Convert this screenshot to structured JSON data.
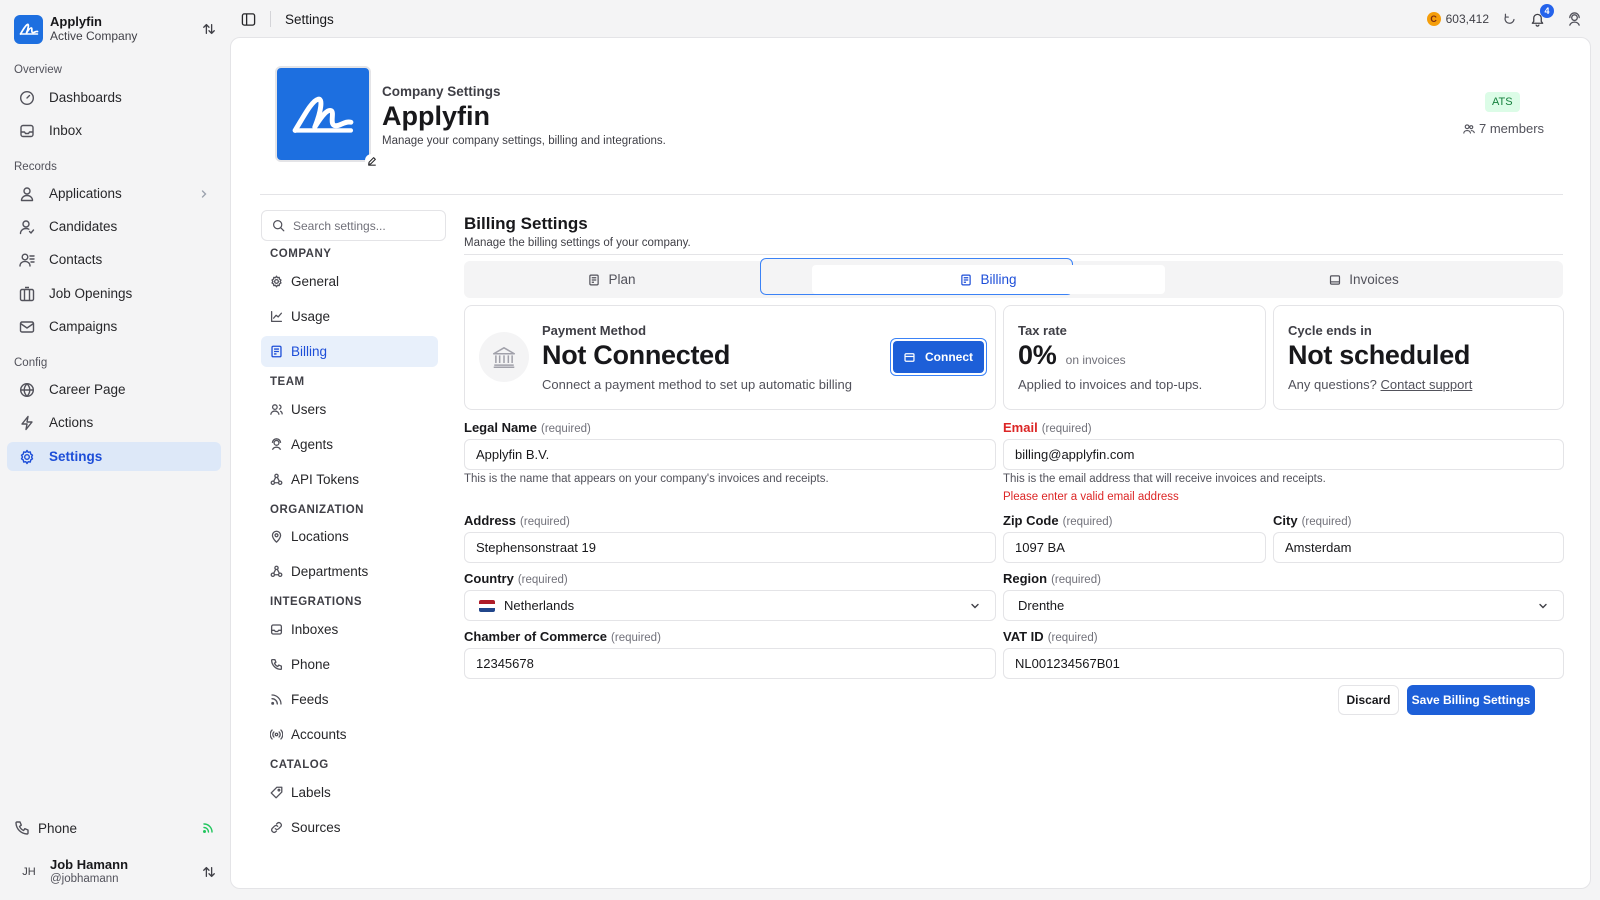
{
  "sidebar": {
    "company_name": "Applyfin",
    "company_sub": "Active Company",
    "sections": [
      "Overview",
      "Records",
      "Config"
    ],
    "items": [
      {
        "label": "Dashboards"
      },
      {
        "label": "Inbox"
      },
      {
        "label": "Applications"
      },
      {
        "label": "Candidates"
      },
      {
        "label": "Contacts"
      },
      {
        "label": "Job Openings"
      },
      {
        "label": "Campaigns"
      },
      {
        "label": "Career Page"
      },
      {
        "label": "Actions"
      },
      {
        "label": "Settings"
      }
    ],
    "phone_label": "Phone",
    "user": {
      "initials": "JH",
      "name": "Job Hamann",
      "handle": "@jobhamann"
    }
  },
  "topbar": {
    "breadcrumb": "Settings",
    "coin_symbol": "C",
    "credits": "603,412",
    "notification_count": "4"
  },
  "header": {
    "small_title": "Company Settings",
    "title": "Applyfin",
    "description": "Manage your company settings, billing and integrations.",
    "badge": "ATS",
    "members": "7 members"
  },
  "settings_nav": {
    "search_placeholder": "Search settings...",
    "groups": [
      "COMPANY",
      "TEAM",
      "ORGANIZATION",
      "INTEGRATIONS",
      "CATALOG"
    ],
    "items": [
      {
        "label": "General"
      },
      {
        "label": "Usage"
      },
      {
        "label": "Billing"
      },
      {
        "label": "Users"
      },
      {
        "label": "Agents"
      },
      {
        "label": "API Tokens"
      },
      {
        "label": "Locations"
      },
      {
        "label": "Departments"
      },
      {
        "label": "Inboxes"
      },
      {
        "label": "Phone"
      },
      {
        "label": "Feeds"
      },
      {
        "label": "Accounts"
      },
      {
        "label": "Labels"
      },
      {
        "label": "Sources"
      }
    ]
  },
  "billing": {
    "title": "Billing Settings",
    "description": "Manage the billing settings of your company.",
    "tabs": [
      {
        "label": "Plan"
      },
      {
        "label": "Billing"
      },
      {
        "label": "Invoices"
      }
    ],
    "active_tab": "Billing",
    "payment": {
      "label": "Payment Method",
      "status": "Not Connected",
      "subtitle": "Connect a payment method to set up automatic billing",
      "button": "Connect"
    },
    "tax": {
      "label": "Tax rate",
      "value": "0%",
      "unit": "on invoices",
      "subtitle": "Applied to invoices and top-ups."
    },
    "cycle": {
      "label": "Cycle ends in",
      "value": "Not scheduled",
      "subtitle": "Any questions?",
      "link": "Contact support"
    },
    "required_text": "(required)",
    "fields": {
      "legal_name": {
        "label": "Legal Name",
        "value": "Applyfin B.V.",
        "help": "This is the name that appears on your company's invoices and receipts."
      },
      "email": {
        "label": "Email",
        "value": "billing@applyfin.com",
        "help": "This is the email address that will receive invoices and receipts.",
        "error": "Please enter a valid email address"
      },
      "address": {
        "label": "Address",
        "value": "Stephensonstraat 19"
      },
      "zip": {
        "label": "Zip Code",
        "value": "1097 BA"
      },
      "city": {
        "label": "City",
        "value": "Amsterdam"
      },
      "country": {
        "label": "Country",
        "value": "Netherlands"
      },
      "region": {
        "label": "Region",
        "value": "Drenthe"
      },
      "coc": {
        "label": "Chamber of Commerce",
        "value": "12345678"
      },
      "vat": {
        "label": "VAT ID",
        "value": "NL001234567B01"
      }
    },
    "discard_label": "Discard",
    "save_label": "Save Billing Settings"
  },
  "colors": {
    "accent": "#1d5fd8",
    "error": "#dc2626",
    "active_bg": "#dde8f8"
  }
}
